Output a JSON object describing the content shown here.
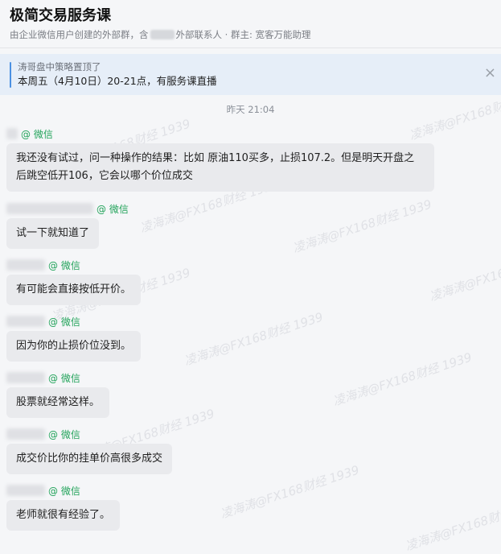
{
  "header": {
    "title": "极简交易服务课",
    "subtitle_prefix": "由企业微信用户创建的外部群，含",
    "subtitle_suffix": "外部联系人 · 群主: 宽客万能助理"
  },
  "pinned": {
    "line1": "涛哥盘中策略置顶了",
    "line2": "本周五（4月10日）20-21点，有服务课直播",
    "close": "×"
  },
  "timestamp": "昨天 21:04",
  "messages": [
    {
      "source": "@ 微信",
      "text": "我还没有试过，问一种操作的结果：比如 原油110买多，止损107.2。但是明天开盘之后跳空低开106，它会以哪个价位成交"
    },
    {
      "source": "@ 微信",
      "text": "试一下就知道了"
    },
    {
      "source": "@ 微信",
      "text": "有可能会直接按低开价。"
    },
    {
      "source": "@ 微信",
      "text": "因为你的止损价位没到。"
    },
    {
      "source": "@ 微信",
      "text": "股票就经常这样。"
    },
    {
      "source": "@ 微信",
      "text": "成交价比你的挂单价高很多成交"
    },
    {
      "source": "@ 微信",
      "text": "老师就很有经验了。"
    }
  ],
  "watermark": "凌海涛@FX168财经 1939"
}
